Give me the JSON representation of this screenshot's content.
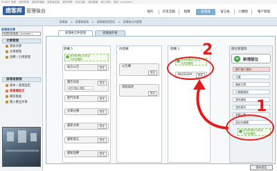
{
  "top_links": [
    "PIXNET 首頁",
    "我的相簿",
    "我的部落格",
    "我的留言板",
    "我的相簿",
    "好友互動",
    "我的最愛",
    "個人資料",
    "登出 ( scenario )"
  ],
  "header": {
    "logo": "痞客邦",
    "site_name": "管理後台",
    "nav": [
      "基本設定",
      "文章",
      "相片",
      "好友互動",
      "相簿",
      "部落格",
      "留言板",
      "小圈圈",
      "帳戶管理"
    ],
    "active_nav": "部落格"
  },
  "breadcrumb": [
    "部落格",
    ">",
    "部落格首頁",
    ">",
    "部落格版型設定",
    ">",
    "部落格元件管理"
  ],
  "sidebar": {
    "title": "部落格名單",
    "blog_select": "阿鐵的部落格 ( scenario )",
    "sections": [
      {
        "head": "文章管理",
        "items": [
          "發表文章",
          "文章管理",
          "迴響 / 引用管理"
        ]
      },
      {
        "head": "部落格管理",
        "items": [
          "基本 / 進階設定",
          "側邊欄設定",
          "網誌版面",
          "匯入匯出文章"
        ],
        "active": "側邊欄設定"
      }
    ]
  },
  "tabs": [
    "部落格元件管理",
    "部落格外掛"
  ],
  "columns": [
    {
      "title": "側欄 1",
      "hint": "放可拖曳此元件至",
      "hint2": "元件放置區",
      "widgets": [
        {
          "label": "站方公告",
          "gear": "設定"
        },
        {
          "label": "廣告訊息",
          "gear": "設定",
          "sub": "站方可加上廣告"
        },
        {
          "label": "熱門文章",
          "gear": "設定"
        },
        {
          "label": "文章分類",
          "gear": "設定"
        },
        {
          "label": "最新文章",
          "gear": "設定"
        },
        {
          "label": "最新留言",
          "gear": "設定"
        },
        {
          "label": "最新迴響",
          "gear": "設定"
        }
      ]
    },
    {
      "title": "內容欄",
      "widgets": [
        {
          "label": "公告欄",
          "gear": "設定"
        },
        {
          "label": "頁面描述",
          "gear": "設定"
        }
      ]
    },
    {
      "title": "側欄 2",
      "hint": "放可拖曳此元件至",
      "hint2": "元件放置區",
      "widgets": [
        {
          "label": "BLOG104",
          "gear": "設定"
        }
      ]
    }
  ],
  "components": {
    "title": "部位管理等",
    "add_label": "新增版位",
    "items": [
      "簡介個人資料",
      "月曆",
      "最新訂閱",
      "小圈圈連結",
      "我的連結",
      "我的寶貝",
      "參觀人數",
      "部站外聯播"
    ],
    "highlighted": "簡介個人資料",
    "hint": "放可拖曳此元件至",
    "hint2": "元件放置區"
  },
  "save_label": "儲存設定",
  "annotations": {
    "n1": "1",
    "n2": "2"
  },
  "colors": {
    "accent": "#2e5fa0",
    "annotation": "#e41b1b",
    "nav_active": "#7bb0d6",
    "green": "#3da33d"
  }
}
